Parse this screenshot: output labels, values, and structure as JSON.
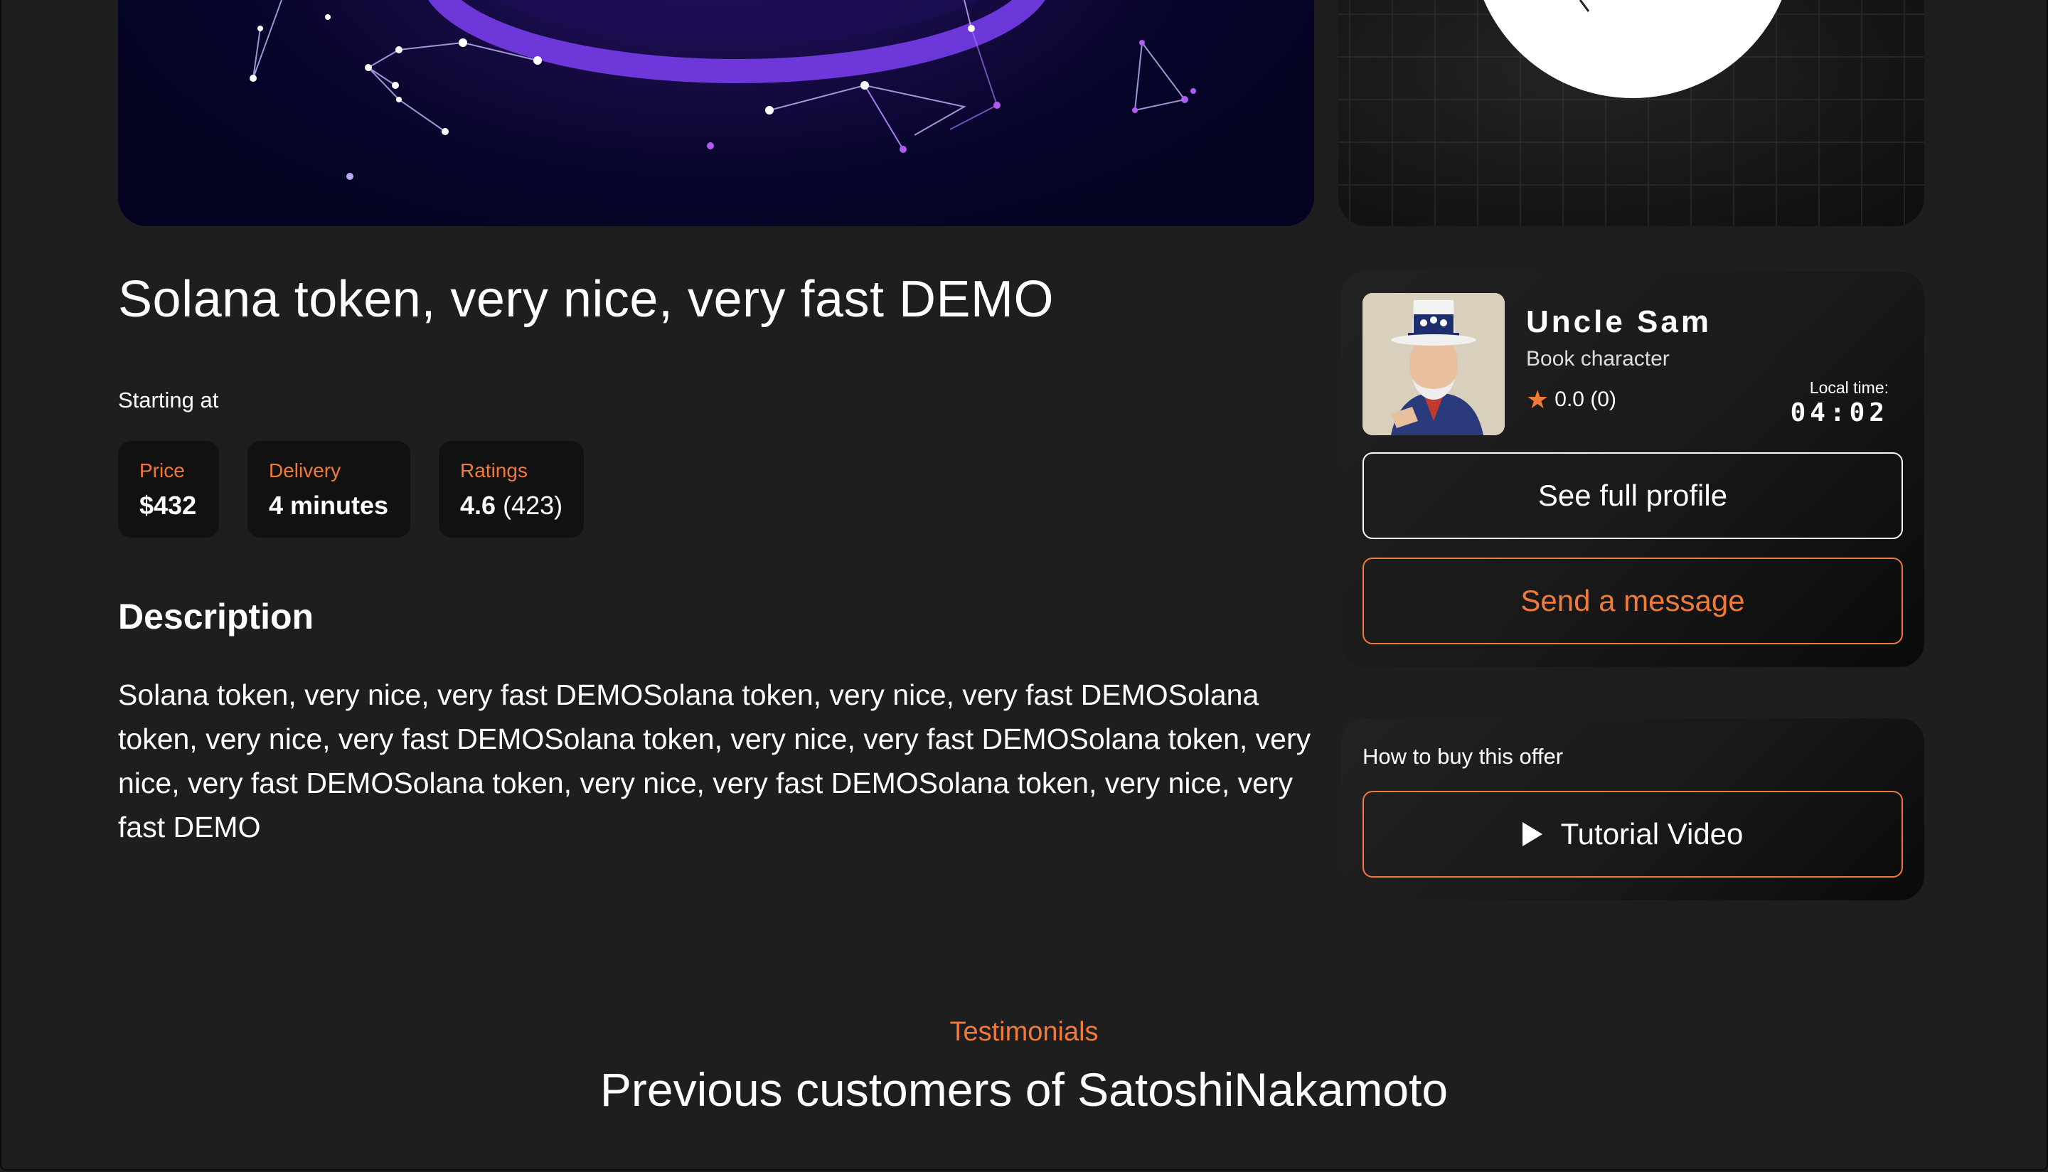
{
  "offer": {
    "title": "Solana token, very nice, very fast DEMO",
    "starting_label": "Starting at",
    "stats": {
      "price": {
        "label": "Price",
        "value": "$432"
      },
      "delivery": {
        "label": "Delivery",
        "value": "4 minutes"
      },
      "ratings": {
        "label": "Ratings",
        "value": "4.6",
        "count": "(423)"
      }
    },
    "description_heading": "Description",
    "description": "Solana token, very nice, very fast DEMOSolana token, very nice, very fast DEMOSolana token, very nice, very fast DEMOSolana token, very nice, very fast DEMOSolana token, very nice, very fast DEMOSolana token, very nice, very fast DEMOSolana token, very nice, very fast DEMO"
  },
  "seller": {
    "name": "Uncle Sam",
    "role": "Book character",
    "rating": "0.0 (0)",
    "local_time_label": "Local time:",
    "local_time": "04:02",
    "see_profile_label": "See full profile",
    "send_message_label": "Send a message"
  },
  "howto": {
    "label": "How to buy this offer",
    "video_label": "Tutorial Video"
  },
  "testimonials": {
    "kicker": "Testimonials",
    "title": "Previous customers of SatoshiNakamoto"
  },
  "colors": {
    "background": "#1e1e1e",
    "accent": "#f07a3a",
    "stat_box": "#111111"
  },
  "icons": [
    "star-icon",
    "play-icon"
  ]
}
